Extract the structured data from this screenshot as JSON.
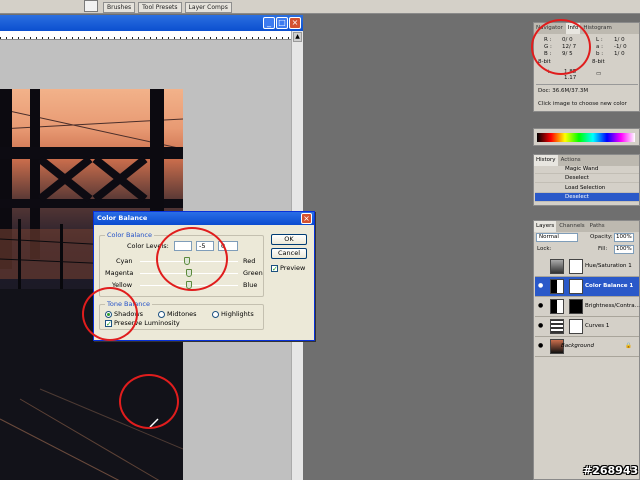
{
  "toolbar": {
    "palette_tabs": [
      "Brushes",
      "Tool Presets",
      "Layer Comps"
    ]
  },
  "color_balance": {
    "title": "Color Balance",
    "section_color_balance": "Color Balance",
    "color_levels_label": "Color Levels:",
    "levels": [
      "",
      "-5",
      "0"
    ],
    "sliders": [
      {
        "left": "Cyan",
        "right": "Red",
        "value": -5
      },
      {
        "left": "Magenta",
        "right": "Green",
        "value": 0
      },
      {
        "left": "Yellow",
        "right": "Blue",
        "value": 0
      }
    ],
    "section_tone_balance": "Tone Balance",
    "tones": [
      "Shadows",
      "Midtones",
      "Highlights"
    ],
    "selected_tone": "Shadows",
    "preserve_luminosity": "Preserve Luminosity",
    "ok": "OK",
    "cancel": "Cancel",
    "preview": "Preview"
  },
  "info_panel": {
    "tabs": [
      "Navigator",
      "Info",
      "Histogram"
    ],
    "r": "R :",
    "r_val": "0/   0",
    "g": "G :",
    "g_val": "12/   7",
    "b": "B :",
    "b_val": "9/   5",
    "l": "L :",
    "l_val": "1/   0",
    "a": "a :",
    "a_val": "-1/   0",
    "bb": "b :",
    "bb_val": "1/   0",
    "bit_left": "8-bit",
    "bit_right": "8-bit",
    "x_val": "1.85",
    "y_val": "1.17",
    "doc": "Doc: 36.6M/37.3M",
    "hint": "Click image to choose new color"
  },
  "history_panel": {
    "tabs": [
      "History",
      "Actions"
    ],
    "items": [
      "Magic Wand",
      "Deselect",
      "Load Selection",
      "Deselect"
    ]
  },
  "layers_panel": {
    "tabs": [
      "Layers",
      "Channels",
      "Paths"
    ],
    "blend_mode": "Normal",
    "opacity_label": "Opacity:",
    "opacity": "100%",
    "lock_label": "Lock:",
    "fill_label": "Fill:",
    "fill": "100%",
    "layers": [
      "Hue/Saturation 1",
      "Color Balance 1",
      "Brightness/Contra...",
      "Curves 1",
      "Background"
    ]
  },
  "watermark": "#268943",
  "colors": {
    "title_blue": "#0a4bd0",
    "annotation_red": "#e01d1d",
    "selection_blue": "#2a59c9"
  }
}
